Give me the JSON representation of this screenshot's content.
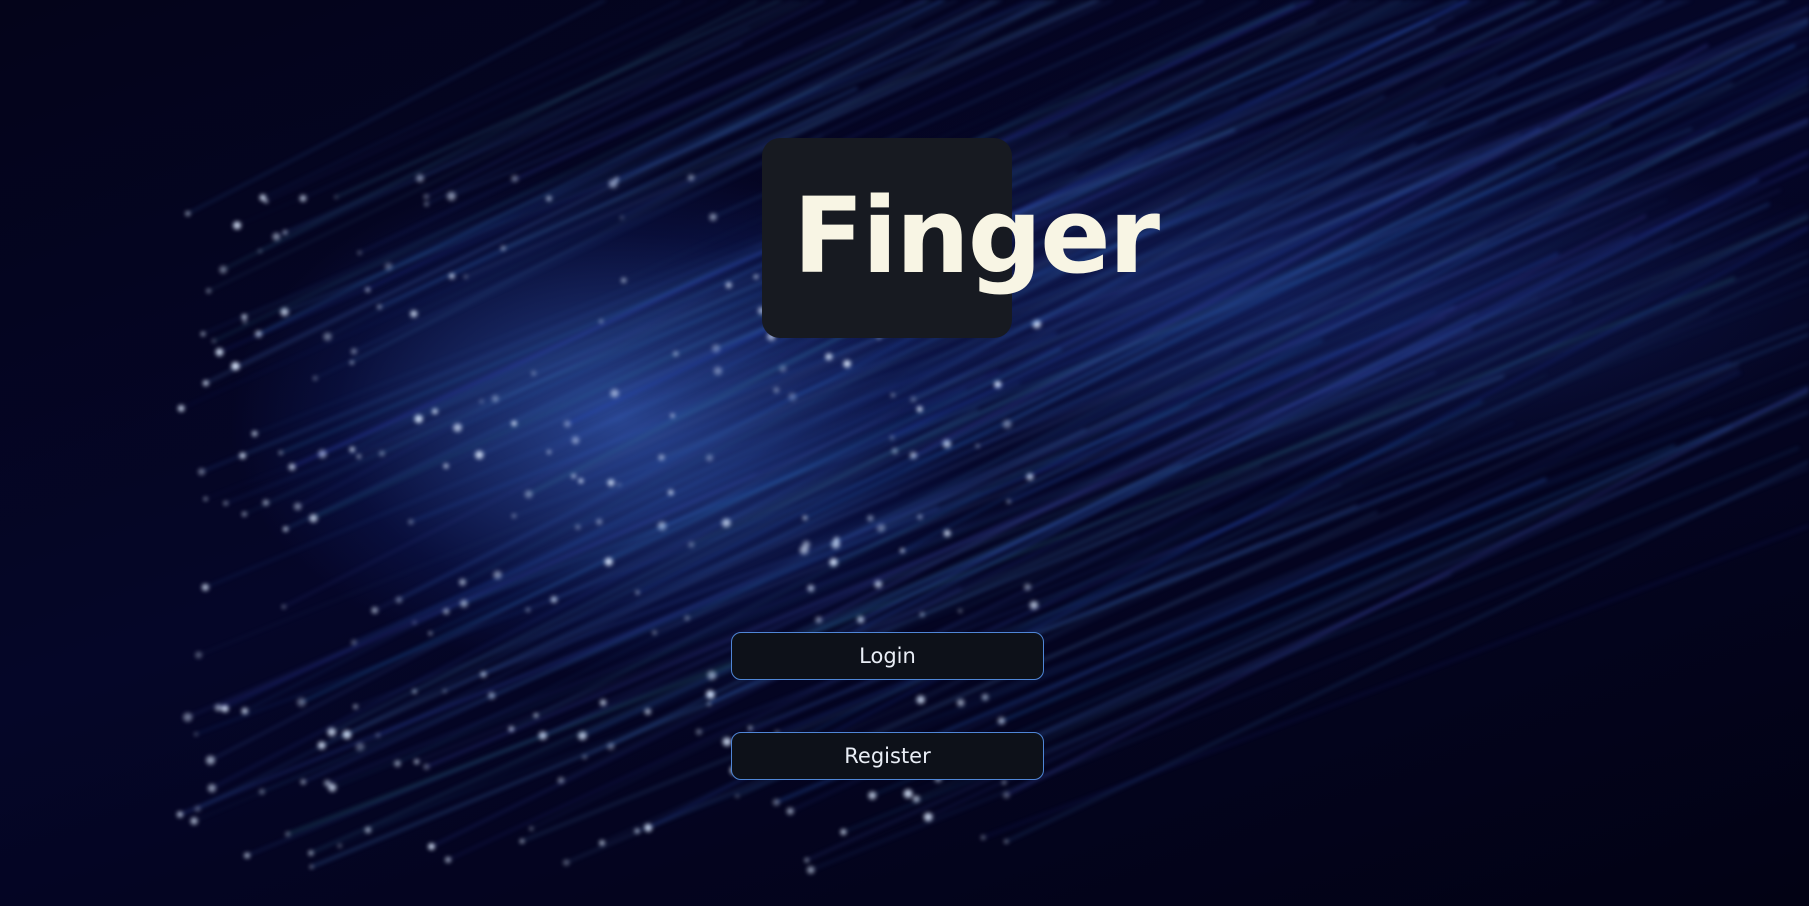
{
  "app": {
    "logo_text": "Finger"
  },
  "actions": {
    "login_label": "Login",
    "register_label": "Register"
  },
  "background": {
    "description_icon": "fiber-optics-background",
    "colors": {
      "base": "#02020c",
      "glow": "#4678e6",
      "fiber_tip": "#dce9ff"
    }
  },
  "theme": {
    "logo_box_color": "#171a21",
    "logo_text_color": "#f8f5e4",
    "button_bg": "#0d1119",
    "button_border": "#4f86d6",
    "button_text": "#e9eef6"
  }
}
